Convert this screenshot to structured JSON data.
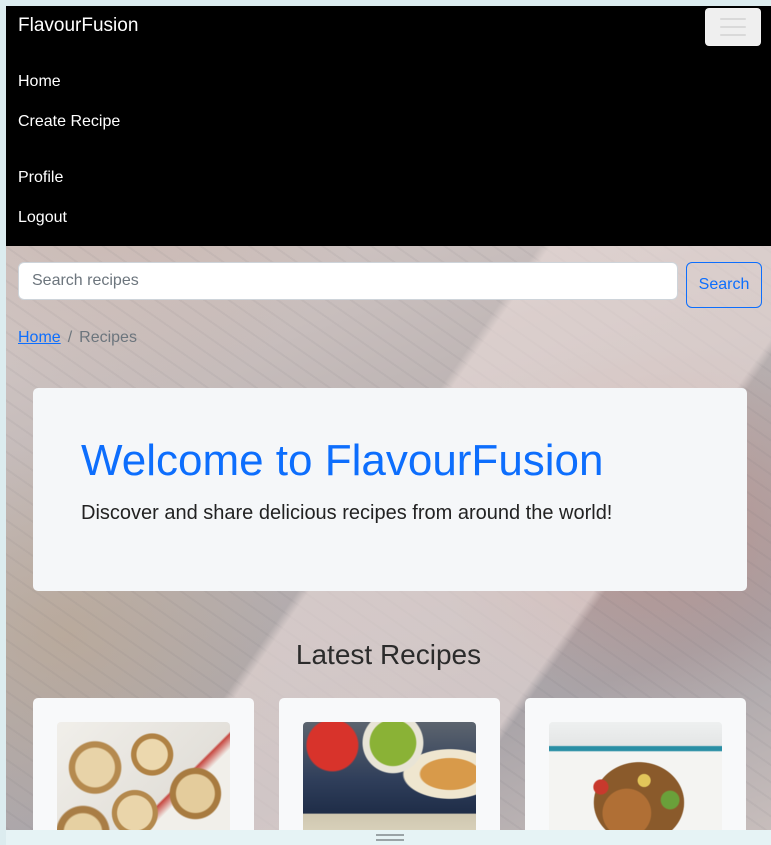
{
  "navbar": {
    "brand": "FlavourFusion",
    "toggler_icon": "hamburger-menu-icon",
    "links": {
      "home": "Home",
      "create_recipe": "Create Recipe",
      "profile": "Profile",
      "logout": "Logout"
    }
  },
  "search": {
    "placeholder": "Search recipes",
    "value": "",
    "button_label": "Search"
  },
  "breadcrumb": {
    "home": "Home",
    "separator": "/",
    "current": "Recipes"
  },
  "hero": {
    "title": "Welcome to FlavourFusion",
    "subtitle": "Discover and share delicious recipes from around the world!"
  },
  "latest": {
    "title": "Latest Recipes"
  },
  "colors": {
    "accent": "#0d6efd",
    "navbar_bg": "#000000",
    "hero_bg": "#f5f7f9"
  }
}
